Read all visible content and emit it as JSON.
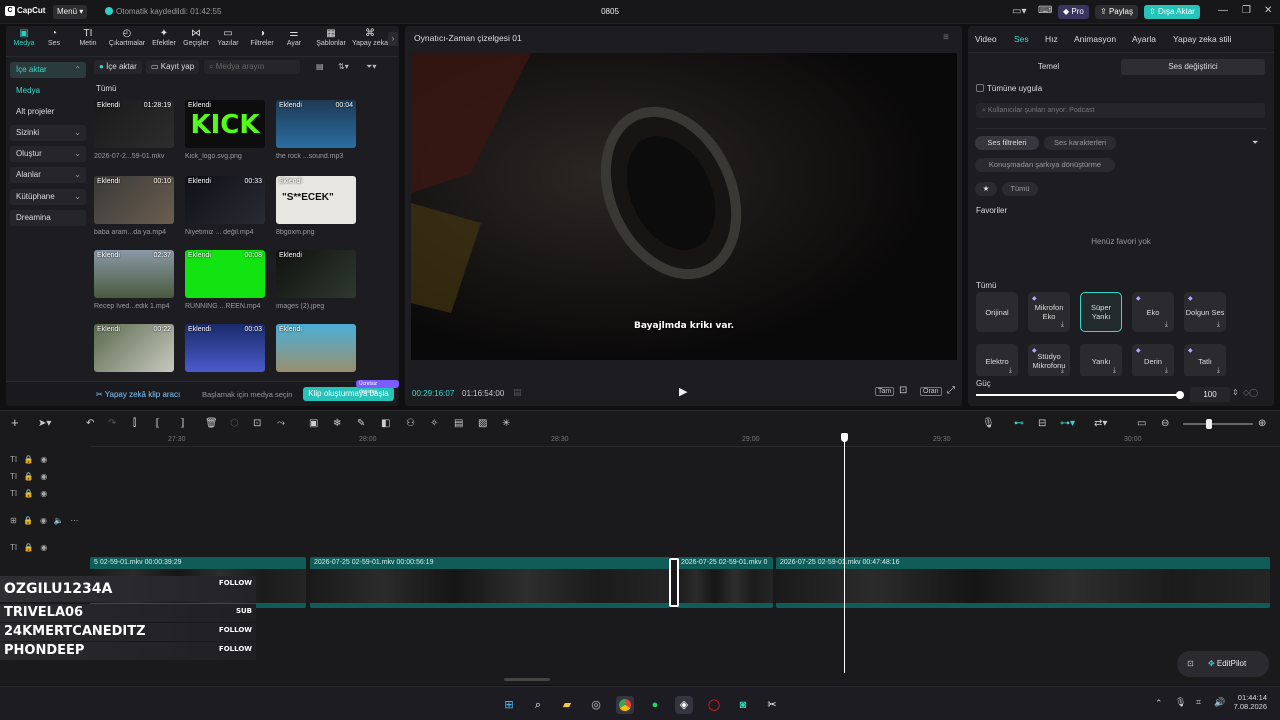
{
  "titlebar": {
    "app_name": "CapCut",
    "menu_label": "Menü",
    "autosave_text": "Otomatik kaydedildi: 01:42:55",
    "project_title": "0805",
    "pro_label": "Pro",
    "share_label": "Paylaş",
    "export_label": "Dışa Aktar"
  },
  "left_tabs": [
    "Medya",
    "Ses",
    "Metin",
    "Çıkartmalar",
    "Efektler",
    "Geçişler",
    "Yazılar",
    "Filtreler",
    "Ayar",
    "Şablonlar",
    "Yapay zeka"
  ],
  "left_nav": [
    "İçe aktar",
    "Medya",
    "Alt projeler",
    "Sizinki",
    "Oluştur",
    "Alanlar",
    "Kütüphane",
    "Dreamina"
  ],
  "media_toolbar": {
    "import_label": "İçe aktar",
    "record_label": "Kayıt yap",
    "search_placeholder": "Medya arayın",
    "all_label": "Tümü"
  },
  "media_items": [
    {
      "tag": "Eklendi",
      "duration": "01:28:19",
      "name": "2026-07-2...59-01.mkv"
    },
    {
      "tag": "Eklendi",
      "duration": "",
      "name": "Kick_logo.svg.png",
      "text": "KICK"
    },
    {
      "tag": "Eklendi",
      "duration": "00:04",
      "name": "the rock ...sound.mp3"
    },
    {
      "tag": "Eklendi",
      "duration": "00:10",
      "name": "baba aram...da ya.mp4"
    },
    {
      "tag": "Eklendi",
      "duration": "00:33",
      "name": "Niyetimiz ... değil.mp4"
    },
    {
      "tag": "Eklendi",
      "duration": "",
      "name": "8bgoxm.png",
      "text": "\"S**ECEK\""
    },
    {
      "tag": "Eklendi",
      "duration": "02:37",
      "name": "Recep İved...edik 1.mp4"
    },
    {
      "tag": "Eklendi",
      "duration": "00:08",
      "name": "RUNNING ...REEN.mp4"
    },
    {
      "tag": "Eklendi",
      "duration": "",
      "name": "images (2).jpeg"
    },
    {
      "tag": "Eklendi",
      "duration": "00:22",
      "name": ""
    },
    {
      "tag": "Eklendi",
      "duration": "00:03",
      "name": ""
    },
    {
      "tag": "Eklendi",
      "duration": "",
      "name": ""
    }
  ],
  "ai_clip": {
    "label": "Yapay zekâ klip aracı",
    "hint": "Başlamak için medya seçin",
    "button": "Klip oluşturmaya başla",
    "badge": "Ücretsiz deneme"
  },
  "player": {
    "title": "Oynatıcı-Zaman çizelgesi 01",
    "subtitle": "Bayajlmda krikı var.",
    "current_time": "00:29:16:07",
    "total_time": "01:16:54:00",
    "btn_full": "Tam",
    "btn_ratio": "Oran"
  },
  "right_tabs": [
    "Video",
    "Ses",
    "Hız",
    "Animasyon",
    "Ayarla",
    "Yapay zeka stili"
  ],
  "right_panel": {
    "sub_tabs": [
      "Temel",
      "Ses değiştirici"
    ],
    "apply_all": "Tümüne uygula",
    "search_placeholder": "Kullanıcılar şunları arıyor: Podcast",
    "filter_pills": [
      "Ses filtreleri",
      "Ses karakterleri"
    ],
    "convert_pill": "Konuşmadan şarkıya dönüştürme",
    "all_pill": "Tümü",
    "favorites_label": "Favoriler",
    "no_favorites": "Henüz favori yok",
    "all_label": "Tümü",
    "voices": [
      "Orijinal",
      "Mikrofon Eko",
      "Süper Yankı",
      "Eko",
      "Dolgun Ses",
      "Elektro",
      "Stüdyo Mikrofonu",
      "Yankı",
      "Derin",
      "Tatlı"
    ],
    "power_label": "Güç",
    "power_value": "100"
  },
  "timeline": {
    "ruler": [
      "27:30",
      "28:00",
      "28:30",
      "29:00",
      "29:30",
      "30:00"
    ],
    "clips": [
      {
        "label": "5 02-59-01.mkv  00:00:39:29"
      },
      {
        "label": "2026-07-25 02-59-01.mkv  00:00:56:19"
      },
      {
        "label": "2026-07-25 02-59-01.mkv  0"
      },
      {
        "label": "2026-07-25 02-59-01.mkv  00:47:48:16"
      }
    ],
    "overlay_names": [
      {
        "name": "OZGILU1234A",
        "action": "FOLLOW"
      },
      {
        "name": "TRIVELA06",
        "action": "SUB"
      },
      {
        "name": "24KMERTCANEDITZ",
        "action": "FOLLOW"
      },
      {
        "name": "PHONDEEP",
        "action": "FOLLOW"
      }
    ],
    "editpilot_label": "EditPilot"
  },
  "taskbar": {
    "time": "01:44:14",
    "date": "7.08.2026"
  }
}
